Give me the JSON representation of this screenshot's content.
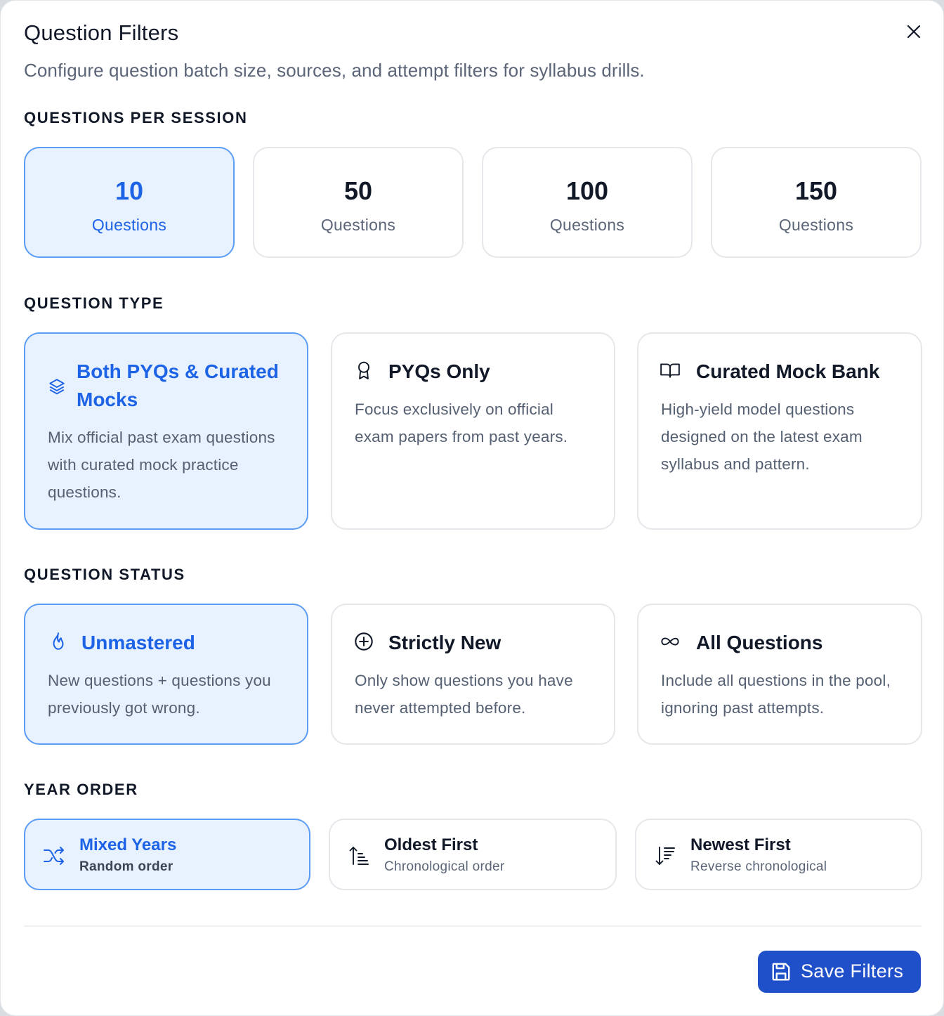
{
  "dialog": {
    "title": "Question Filters",
    "subtitle": "Configure question batch size, sources, and attempt filters for syllabus drills.",
    "close_icon": "close-icon"
  },
  "questions_per_session": {
    "heading": "QUESTIONS PER SESSION",
    "selected": "10",
    "options": [
      {
        "value": "10",
        "label": "Questions"
      },
      {
        "value": "50",
        "label": "Questions"
      },
      {
        "value": "100",
        "label": "Questions"
      },
      {
        "value": "150",
        "label": "Questions"
      }
    ]
  },
  "question_type": {
    "heading": "QUESTION TYPE",
    "selected": "Both PYQs & Curated Mocks",
    "options": [
      {
        "icon": "layers-icon",
        "title": "Both PYQs & Curated Mocks",
        "description": "Mix official past exam questions with curated mock practice questions."
      },
      {
        "icon": "award-icon",
        "title": "PYQs Only",
        "description": "Focus exclusively on official exam papers from past years."
      },
      {
        "icon": "book-open-icon",
        "title": "Curated Mock Bank",
        "description": "High-yield model questions designed on the latest exam syllabus and pattern."
      }
    ]
  },
  "question_status": {
    "heading": "QUESTION STATUS",
    "selected": "Unmastered",
    "options": [
      {
        "icon": "flame-icon",
        "title": "Unmastered",
        "description": "New questions + questions you previously got wrong."
      },
      {
        "icon": "plus-circle-icon",
        "title": "Strictly New",
        "description": "Only show questions you have never attempted before."
      },
      {
        "icon": "infinity-icon",
        "title": "All Questions",
        "description": "Include all questions in the pool, ignoring past attempts."
      }
    ]
  },
  "year_order": {
    "heading": "YEAR ORDER",
    "selected": "Mixed Years",
    "options": [
      {
        "icon": "shuffle-icon",
        "title": "Mixed Years",
        "subtitle": "Random order"
      },
      {
        "icon": "sort-ascending-icon",
        "title": "Oldest First",
        "subtitle": "Chronological order"
      },
      {
        "icon": "sort-descending-icon",
        "title": "Newest First",
        "subtitle": "Reverse chronological"
      }
    ]
  },
  "footer": {
    "save_label": "Save Filters",
    "save_icon": "save-icon"
  },
  "colors": {
    "accent": "#1d63e6",
    "selected_bg": "#e8f1fe",
    "selected_border": "#5b9cf5",
    "save_button": "#1f4fc9"
  }
}
